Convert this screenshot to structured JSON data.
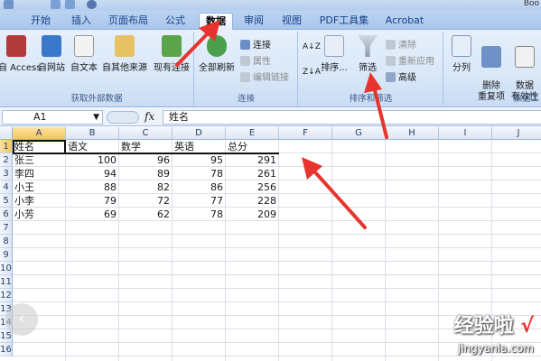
{
  "app": {
    "doc_title_fragment": "Boo"
  },
  "ribbon_tabs": [
    "开始",
    "插入",
    "页面布局",
    "公式",
    "数据",
    "审阅",
    "视图",
    "PDF工具集",
    "Acrobat"
  ],
  "active_tab": "数据",
  "groups": {
    "external_data": {
      "label": "获取外部数据",
      "buttons": [
        "自 Access",
        "自网站",
        "自文本",
        "自其他来源",
        "现有连接"
      ]
    },
    "connections": {
      "label": "连接",
      "refresh_all": "全部刷新",
      "connections_btn": "连接",
      "properties_btn": "属性",
      "edit_links_btn": "编辑链接"
    },
    "sort_filter": {
      "label": "排序和筛选",
      "az_btn": "A↓Z",
      "za_btn": "Z↓A",
      "sort_btn": "排序...",
      "filter_btn": "筛选",
      "clear_btn": "清除",
      "reapply_btn": "重新应用",
      "advanced_btn": "高级"
    },
    "data_tools": {
      "label": "数据工",
      "split_btn": "分列",
      "remove_dup_btn": "删除\n重复项",
      "validation_btn": "数据\n有效性"
    }
  },
  "formula_bar": {
    "name_box": "A1",
    "fx": "fx",
    "content": "姓名"
  },
  "columns": [
    "A",
    "B",
    "C",
    "D",
    "E",
    "F",
    "G",
    "H",
    "I",
    "J"
  ],
  "rows": [
    "1",
    "2",
    "3",
    "4",
    "5",
    "6",
    "7",
    "8",
    "9",
    "10",
    "11",
    "12",
    "13",
    "14",
    "15",
    "16"
  ],
  "table": {
    "headers": [
      "姓名",
      "语文",
      "数学",
      "英语",
      "总分"
    ],
    "records": [
      [
        "张三",
        "100",
        "96",
        "95",
        "291"
      ],
      [
        "李四",
        "94",
        "89",
        "78",
        "261"
      ],
      [
        "小王",
        "88",
        "82",
        "86",
        "256"
      ],
      [
        "小李",
        "79",
        "72",
        "77",
        "228"
      ],
      [
        "小芳",
        "69",
        "62",
        "78",
        "209"
      ]
    ]
  },
  "watermark": {
    "title": "经验啦",
    "check": "√",
    "url": "jingyanla.com"
  },
  "colors": {
    "ribbon_bg": "#d9e7f8",
    "tab_text": "#15428b",
    "selected_header": "#f7c65d",
    "arrow_red": "#e8342f"
  }
}
